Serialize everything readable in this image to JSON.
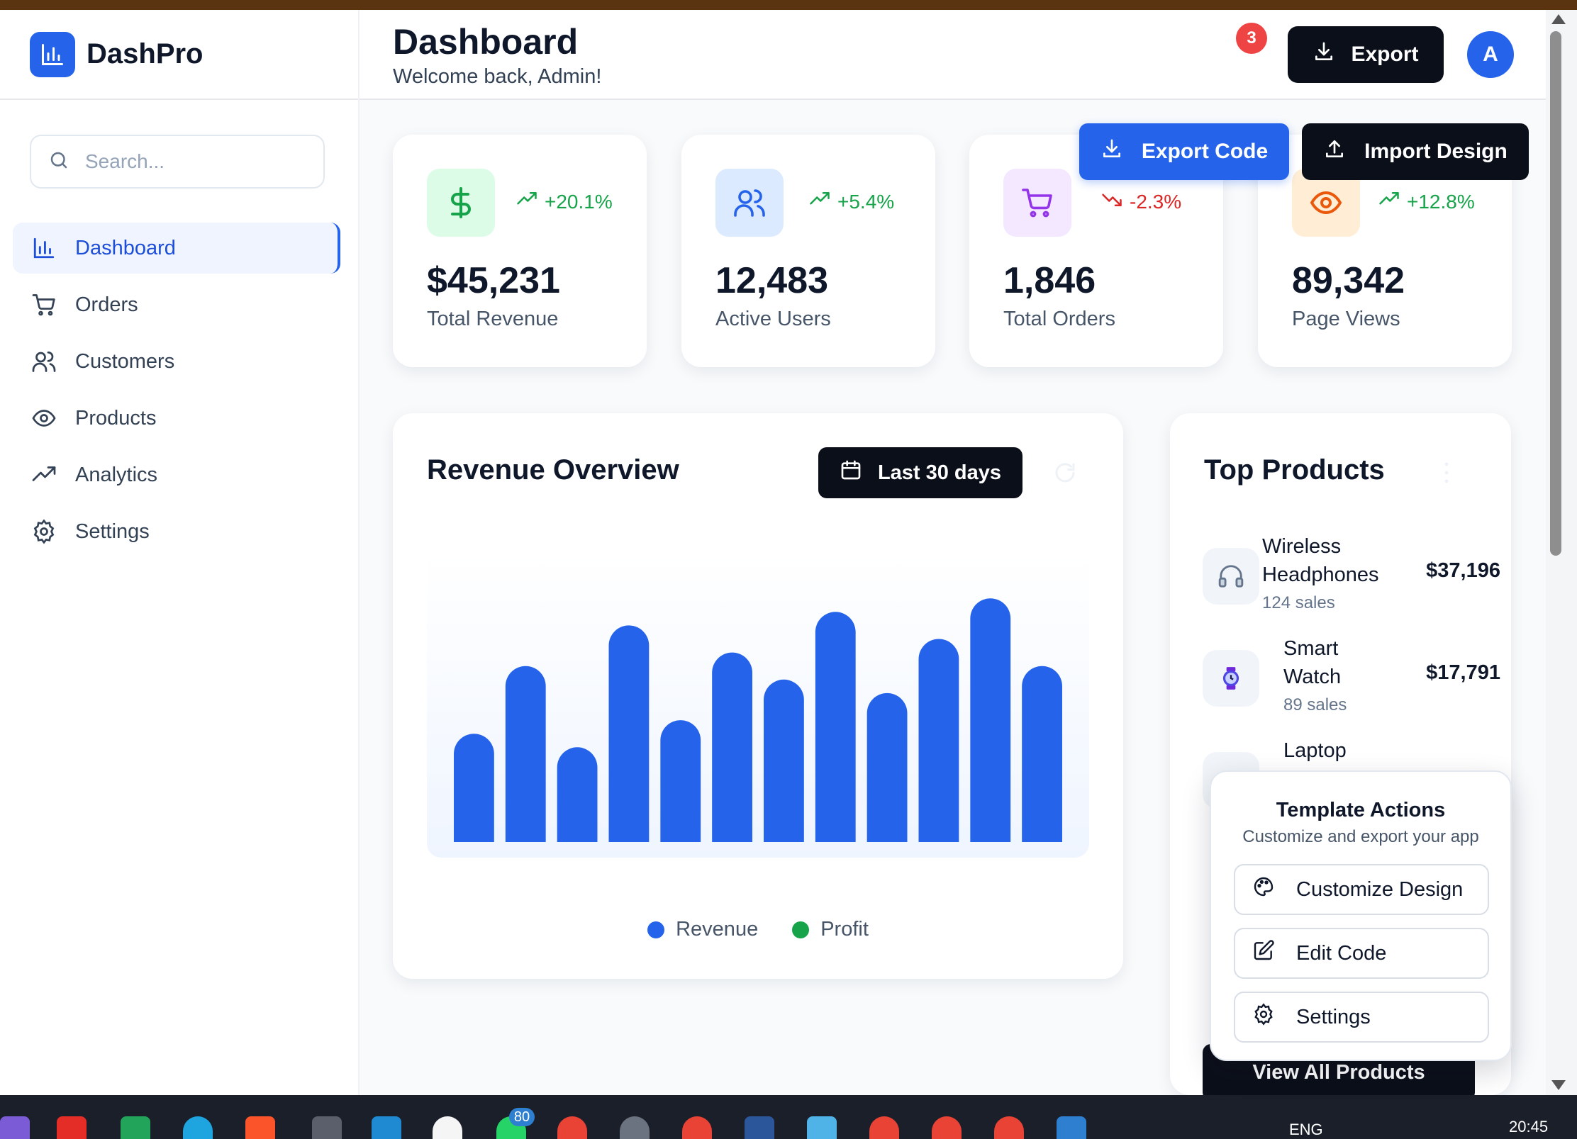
{
  "brand": {
    "name": "DashPro"
  },
  "search": {
    "placeholder": "Search..."
  },
  "sidebar": {
    "items": [
      {
        "label": "Dashboard",
        "icon": "bar-chart-icon",
        "active": true
      },
      {
        "label": "Orders",
        "icon": "cart-icon"
      },
      {
        "label": "Customers",
        "icon": "users-icon"
      },
      {
        "label": "Products",
        "icon": "eye-icon"
      },
      {
        "label": "Analytics",
        "icon": "trending-up-icon"
      },
      {
        "label": "Settings",
        "icon": "gear-icon"
      }
    ]
  },
  "header": {
    "title": "Dashboard",
    "subtitle": "Welcome back, Admin!",
    "notification_count": "3",
    "export_label": "Export",
    "avatar_initial": "A"
  },
  "actions": {
    "export_code": "Export Code",
    "import_design": "Import Design"
  },
  "stats": [
    {
      "value": "$45,231",
      "label": "Total Revenue",
      "change": "+20.1%",
      "direction": "up",
      "icon": "dollar-icon",
      "color": "#16a34a"
    },
    {
      "value": "12,483",
      "label": "Active Users",
      "change": "+5.4%",
      "direction": "up",
      "icon": "users-icon",
      "color": "#2563eb"
    },
    {
      "value": "1,846",
      "label": "Total Orders",
      "change": "-2.3%",
      "direction": "down",
      "icon": "cart-icon",
      "color": "#9333ea"
    },
    {
      "value": "89,342",
      "label": "Page Views",
      "change": "+12.8%",
      "direction": "up",
      "icon": "eye-icon",
      "color": "#ea580c"
    }
  ],
  "revenue": {
    "title": "Revenue Overview",
    "range_label": "Last 30 days"
  },
  "chart_data": {
    "type": "bar",
    "title": "Revenue Overview",
    "categories": [],
    "series": [
      {
        "name": "Revenue",
        "color": "#2563eb",
        "values": [
          40,
          65,
          35,
          80,
          45,
          70,
          60,
          85,
          55,
          75,
          90,
          65
        ]
      }
    ],
    "ylim": [
      0,
      100
    ],
    "legend": [
      {
        "name": "Revenue",
        "color": "#2563eb"
      },
      {
        "name": "Profit",
        "color": "#16a34a"
      }
    ],
    "legend_position": "bottom-center",
    "grid": false
  },
  "top_products": {
    "title": "Top Products",
    "items": [
      {
        "name_line1": "Wireless",
        "name_line2": "Headphones",
        "sales": "124 sales",
        "price": "$37,196",
        "icon": "headphones-icon"
      },
      {
        "name_line1": "Smart",
        "name_line2": "Watch",
        "sales": "89 sales",
        "price": "$17,791",
        "icon": "watch-icon"
      },
      {
        "name_line1": "Laptop",
        "name_line2": "",
        "sales": "",
        "price": "",
        "icon": "laptop-icon"
      }
    ],
    "view_all": "View All Products"
  },
  "template_actions": {
    "title": "Template Actions",
    "subtitle": "Customize and export your app",
    "buttons": [
      {
        "label": "Customize Design",
        "icon": "palette-icon"
      },
      {
        "label": "Edit Code",
        "icon": "edit-icon"
      },
      {
        "label": "Settings",
        "icon": "gear-icon"
      }
    ]
  },
  "taskbar": {
    "badge_1": "80",
    "language": "ENG",
    "time": "20:45"
  }
}
